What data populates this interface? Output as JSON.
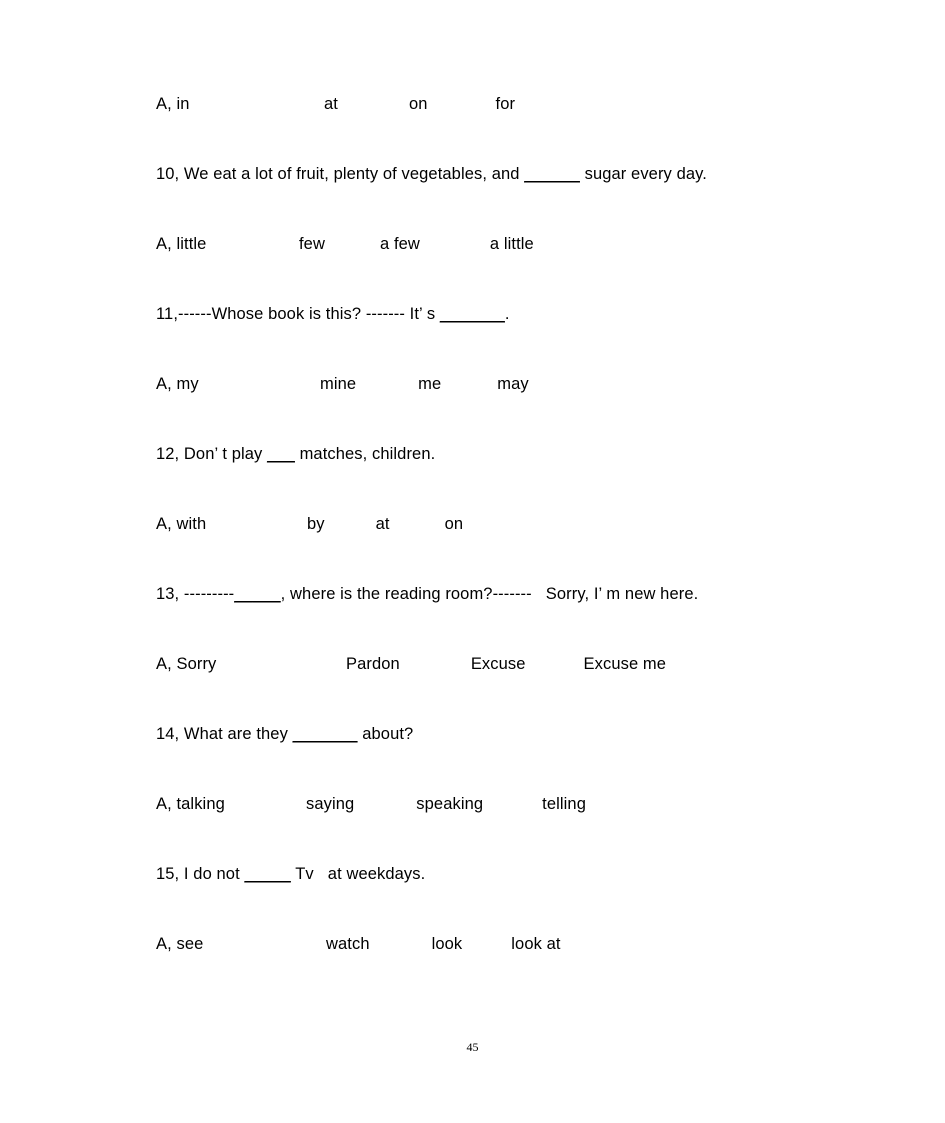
{
  "document": {
    "page_number": "45",
    "lines": [
      {
        "kind": "options",
        "name": "options-row-9",
        "label": "A, in",
        "choices": [
          "at",
          "on",
          "for"
        ],
        "gaps": [
          74,
          71,
          68
        ]
      },
      {
        "kind": "question",
        "name": "question-10",
        "pre": "10, We eat a lot of fruit, plenty of vegetables, and ",
        "blank": "______",
        "post": " sugar every day."
      },
      {
        "kind": "options",
        "name": "options-row-10",
        "label": "A, little",
        "choices": [
          "few",
          "a few",
          "a little"
        ],
        "gaps": [
          49,
          55,
          70
        ]
      },
      {
        "kind": "question",
        "name": "question-11",
        "pre": "11,------Whose book is this? ------- It’ s ",
        "blank": "_______",
        "post": "."
      },
      {
        "kind": "options",
        "name": "options-row-11",
        "label": "A, my",
        "choices": [
          "mine",
          "me",
          "may"
        ],
        "gaps": [
          70,
          62,
          56
        ]
      },
      {
        "kind": "question",
        "name": "question-12",
        "pre": "12, Don’ t play ",
        "blank": "___",
        "post": " matches, children."
      },
      {
        "kind": "options",
        "name": "options-row-12",
        "label": "A, with",
        "choices": [
          "by",
          "at",
          "on"
        ],
        "gaps": [
          57,
          51,
          55
        ]
      },
      {
        "kind": "question",
        "name": "question-13",
        "pre": "13, ---------",
        "blank": "_____",
        "post": ", where is the reading room?-------   Sorry, I’ m new here."
      },
      {
        "kind": "options",
        "name": "options-row-13",
        "label": "A, Sorry",
        "choices": [
          "Pardon",
          "Excuse",
          "Excuse me"
        ],
        "gaps": [
          96,
          71,
          58
        ]
      },
      {
        "kind": "question",
        "name": "question-14",
        "pre": "14, What are they ",
        "blank": "_______",
        "post": " about?"
      },
      {
        "kind": "options",
        "name": "options-row-14",
        "label": "A, talking",
        "choices": [
          "saying",
          "speaking",
          "telling"
        ],
        "gaps": [
          56,
          62,
          59
        ]
      },
      {
        "kind": "question",
        "name": "question-15",
        "pre": "15, I do not ",
        "blank": "_____",
        "post": " Tv   at weekdays."
      },
      {
        "kind": "options",
        "name": "options-row-15",
        "label": "A, see",
        "choices": [
          "watch",
          "look",
          "look at"
        ],
        "gaps": [
          76,
          62,
          49
        ]
      }
    ]
  }
}
